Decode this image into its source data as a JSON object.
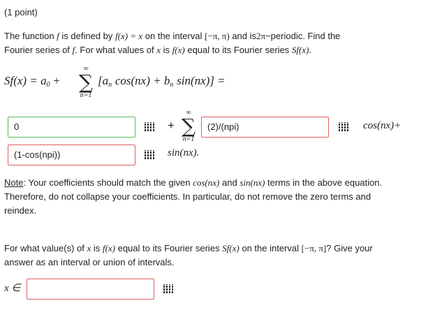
{
  "header": {
    "points": "(1 point)"
  },
  "question1": {
    "line1_a": "The function",
    "f": "f",
    "line1_b": "is defined by",
    "fx": "f(x) = x",
    "line1_c": "on the interval",
    "interval": "[−π, π)",
    "line1_d": "and is",
    "period": "2π",
    "line1_e": "−periodic. Find the",
    "line2_a": "Fourier series of",
    "f2": "f",
    "line2_b": ". For what values of",
    "x": "x",
    "line2_c": "is",
    "fx2": "f(x)",
    "line2_d": "equal to its Fourier series",
    "sfx": "Sf(x)",
    "line2_e": "."
  },
  "formula": {
    "lhs": "Sf(x) = a",
    "a_sub": "0",
    "plus": "+",
    "sigma": "∑",
    "sup": "∞",
    "sub": "n=1",
    "bracket_open": "[a",
    "an_sub": "n",
    "cos_term": "cos(nx) + b",
    "bn_sub": "n",
    "sin_term": "sin(nx)] ="
  },
  "answer_row": {
    "a0_value": "0",
    "plus_sigma": "+",
    "sigma": "∑",
    "sup": "∞",
    "sub": "n=1",
    "an_value": "(2)/(npi)",
    "cos_label": "cos(nx)+",
    "bn_value": "(1-cos(npi))",
    "sin_label": "sin(nx)."
  },
  "note": {
    "label": "Note",
    "colon": ":",
    "l1_a": "Your coefficients should match the given",
    "cos": "cos(nx)",
    "l1_b": "and",
    "sin": "sin(nx)",
    "l1_c": "terms in the above equation.",
    "l2": "Therefore, do not collapse your coefficients. In particular, do not remove the zero terms and",
    "l3": "reindex."
  },
  "question2": {
    "a": "For what value(s) of",
    "x": "x",
    "b": "is",
    "fx": "f(x)",
    "c": "equal to its Fourier series",
    "sfx": "Sf(x)",
    "d": "on the interval",
    "interval": "[−π, π]",
    "e": "? Give your",
    "line2": "answer as an interval or union of intervals.",
    "xin": "x ∈",
    "answer_value": ""
  }
}
